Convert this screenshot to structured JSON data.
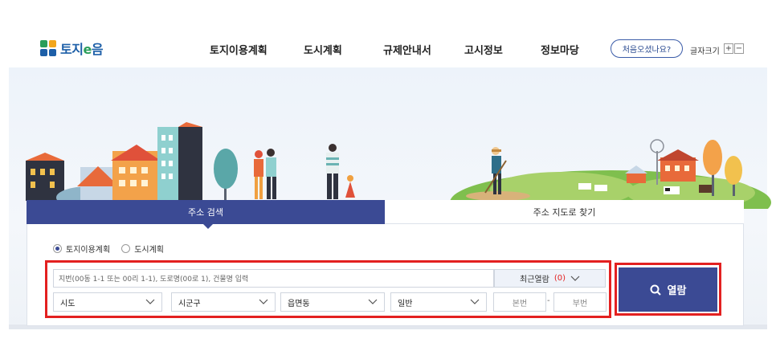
{
  "logo": {
    "text_main": "토지",
    "text_e": "e",
    "text_tail": "음"
  },
  "nav": [
    {
      "label": "토지이용계획"
    },
    {
      "label": "도시계획"
    },
    {
      "label": "규제안내서"
    },
    {
      "label": "고시정보"
    },
    {
      "label": "정보마당"
    }
  ],
  "first_visit": "처음오셨나요?",
  "font_size": {
    "label": "글자크기",
    "plus": "+",
    "minus": "−"
  },
  "tabs": {
    "address_search": "주소 검색",
    "map_search": "주소 지도로 찾기"
  },
  "radio": {
    "option1": "토지이용계획",
    "option2": "도시계획",
    "selected": "토지이용계획"
  },
  "search": {
    "placeholder": "지번(00동 1-1 또는 00리 1-1), 도로명(00로 1), 건물명 입력",
    "recent_label": "최근열람",
    "recent_count": "(0)"
  },
  "selects": {
    "sido": "시도",
    "sigungu": "시군구",
    "eupmyeondong": "읍면동",
    "type": "일반"
  },
  "lot": {
    "main_placeholder": "본번",
    "dash": "-",
    "sub_placeholder": "부번"
  },
  "open_button": "열람",
  "colors": {
    "primary": "#3b4a94",
    "highlight": "#e32020",
    "logo_blue": "#1d5fa8",
    "logo_green": "#2a9e5a"
  }
}
